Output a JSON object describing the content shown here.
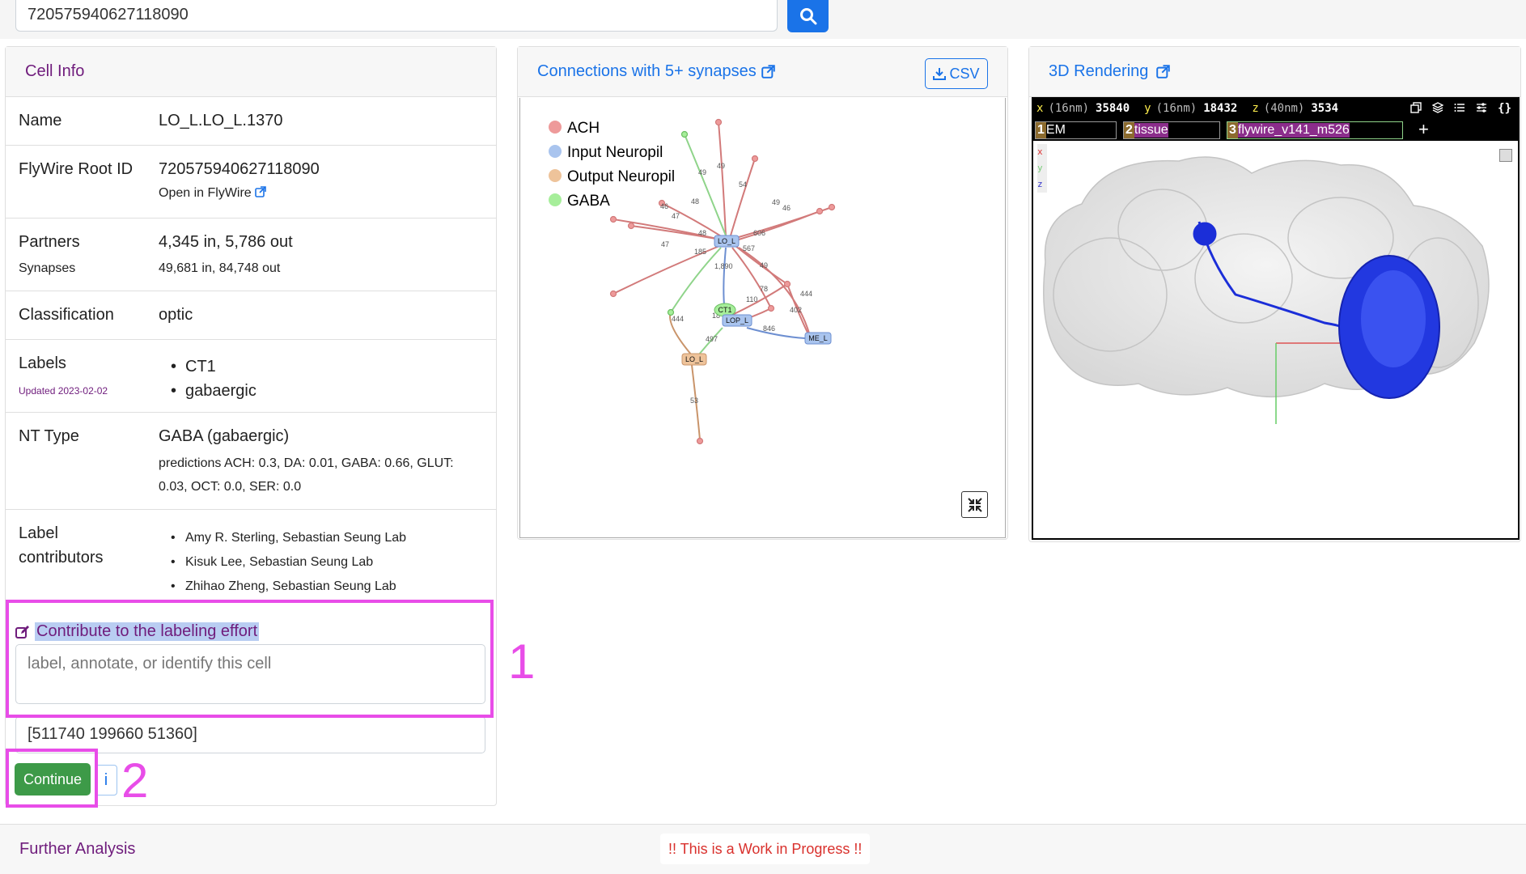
{
  "search": {
    "value": "720575940627118090"
  },
  "cell_info": {
    "title": "Cell Info",
    "name_label": "Name",
    "name_value": "LO_L.LO_L.1370",
    "root_label": "FlyWire Root ID",
    "root_value": "720575940627118090",
    "open_link": "Open in FlyWire",
    "partners_label": "Partners",
    "partners_value": "4,345 in, 5,786 out",
    "synapses_label": "Synapses",
    "synapses_value": "49,681 in, 84,748 out",
    "class_label": "Classification",
    "class_value": "optic",
    "labels_label": "Labels",
    "labels_updated": "Updated 2023-02-02",
    "labels": [
      "CT1",
      "gabaergic"
    ],
    "nt_label": "NT Type",
    "nt_value": "GABA (gabaergic)",
    "nt_predictions_1": "predictions ACH: 0.3, DA: 0.01, GABA: 0.66, GLUT:",
    "nt_predictions_2": "0.03, OCT: 0.0, SER: 0.0",
    "contrib_label_1": "Label",
    "contrib_label_2": "contributors",
    "contributors": [
      "Amy R. Sterling, Sebastian Seung Lab",
      "Kisuk Lee, Sebastian Seung Lab",
      "Zhihao Zheng, Sebastian Seung Lab"
    ],
    "contribute_link": "Contribute to the labeling effort",
    "annotate_placeholder": "label, annotate, or identify this cell",
    "coords_value": "[511740 199660  51360]",
    "continue_label": "Continue",
    "info_label": "i"
  },
  "highlights": {
    "one": "1",
    "two": "2"
  },
  "connections": {
    "title": "Connections with 5+ synapses",
    "csv_label": "CSV",
    "legend": [
      {
        "label": "ACH",
        "color": "#ee9a9a"
      },
      {
        "label": "Input Neuropil",
        "color": "#a9c4ee"
      },
      {
        "label": "Output Neuropil",
        "color": "#eec39a"
      },
      {
        "label": "GABA",
        "color": "#a6ee9a"
      }
    ],
    "nodes": {
      "lo_top": "LO_L",
      "ct1": "CT1",
      "lop": "LOP_L",
      "me": "ME_L",
      "lo_bottom": "LO_L"
    },
    "edge_labels": [
      "49",
      "49",
      "54",
      "48",
      "46",
      "47",
      "49",
      "46",
      "47",
      "48",
      "185",
      "606",
      "567",
      "1,890",
      "49",
      "78",
      "110",
      "444",
      "402",
      "846",
      "18",
      "497",
      "444",
      "53"
    ]
  },
  "rendering": {
    "title": "3D Rendering",
    "x_label": "x",
    "x_unit": "(16nm)",
    "x_value": "35840",
    "y_label": "y",
    "y_unit": "(16nm)",
    "y_value": "18432",
    "z_label": "z",
    "z_unit": "(40nm)",
    "z_value": "3534",
    "layers": [
      {
        "num": "1",
        "name": "EM"
      },
      {
        "num": "2",
        "name": "tissue"
      },
      {
        "num": "3",
        "name": "flywire_v141_m526"
      }
    ],
    "add_label": "+",
    "axis_x": "x",
    "axis_y": "y",
    "axis_z": "z"
  },
  "further": {
    "title": "Further Analysis",
    "wip": "!! This is a Work in Progress !!"
  }
}
